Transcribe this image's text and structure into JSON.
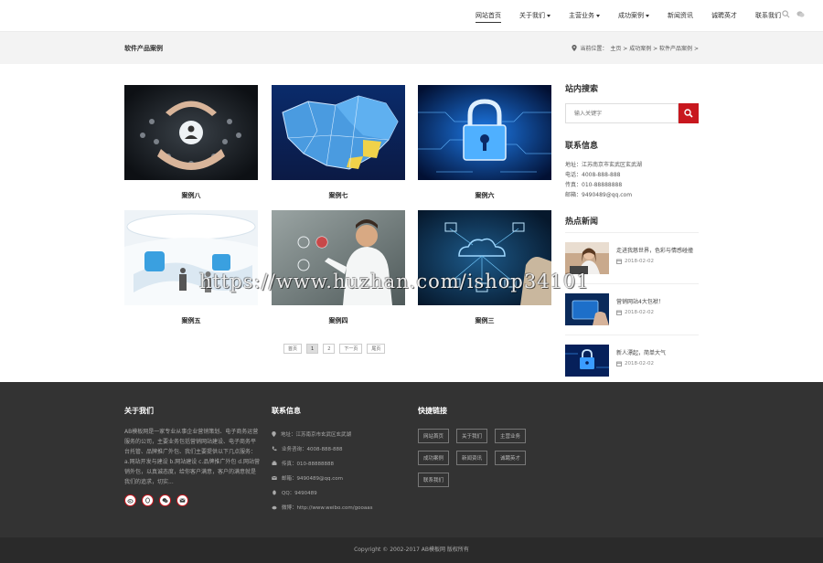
{
  "nav": {
    "items": [
      {
        "label": "网站首页",
        "active": true,
        "dropdown": false
      },
      {
        "label": "关于我们",
        "active": false,
        "dropdown": true
      },
      {
        "label": "主营业务",
        "active": false,
        "dropdown": true
      },
      {
        "label": "成功案例",
        "active": false,
        "dropdown": true
      },
      {
        "label": "新闻资讯",
        "active": false,
        "dropdown": false
      },
      {
        "label": "诚聘英才",
        "active": false,
        "dropdown": false
      },
      {
        "label": "联系我们",
        "active": false,
        "dropdown": false
      }
    ],
    "icons": [
      "search-icon",
      "wechat-icon"
    ]
  },
  "crumbbar": {
    "title": "软件产品案例",
    "location_label": "当前位置：",
    "path": "主页 > 成功案例 > 软件产品案例 >"
  },
  "cases": [
    {
      "caption": "案例八",
      "image": "handshake-people-network"
    },
    {
      "caption": "案例七",
      "image": "map-china-3d"
    },
    {
      "caption": "案例六",
      "image": "padlock-circuit-blue"
    },
    {
      "caption": "案例五",
      "image": "futuristic-white-interior"
    },
    {
      "caption": "案例四",
      "image": "businessman-touchscreen"
    },
    {
      "caption": "案例三",
      "image": "hand-cloud-icons"
    }
  ],
  "pagination": {
    "items": [
      {
        "label": "首页",
        "current": false
      },
      {
        "label": "1",
        "current": true
      },
      {
        "label": "2",
        "current": false
      },
      {
        "label": "下一页",
        "current": false
      },
      {
        "label": "尾页",
        "current": false
      }
    ]
  },
  "sidebar": {
    "search_title": "站内搜索",
    "search_placeholder": "输入关键字",
    "contact_title": "联系信息",
    "contact_lines": [
      "地址：江苏南京市玄武区玄武湖",
      "电话：4008-888-888",
      "传真：010-88888888",
      "邮箱：9490489@qq.com"
    ],
    "news_title": "热点新闻",
    "news": [
      {
        "title": "走进我慈世界，色彩与情感碰撞",
        "date": "2018-02-02",
        "image": "woman-laptop"
      },
      {
        "title": "营销网站4大包袱！",
        "date": "2018-02-02",
        "image": "hand-tablet-blue"
      },
      {
        "title": "新人漂起，简单大气",
        "date": "2018-02-02",
        "image": "padlock-blue"
      }
    ]
  },
  "footer": {
    "about_title": "关于我们",
    "about_text": "AB模板网是一家专业从事企业营销策划、电子商务运营服务的公司，主要业务包括营销网站建设、电子商务平台托管、品牌推广外包、我们主要提供以下几点服务：a.网站开发与建设 b.网站建设 c.品牌推广外包 d.网站营销外包，以真诚态度，给你客户满意，客户的满意就是我们的追求，切实...",
    "social_icons": [
      "weibo-icon",
      "qq-icon",
      "wechat-icon",
      "email-icon"
    ],
    "contact_title": "联系信息",
    "contact_lines": [
      {
        "icon": "location-icon",
        "text": "地址：江苏南京市玄武区玄武湖"
      },
      {
        "icon": "phone-icon",
        "text": "业务咨询：4008-888-888"
      },
      {
        "icon": "fax-icon",
        "text": "传真：010-88888888"
      },
      {
        "icon": "email-icon",
        "text": "邮箱：9490489@qq.com"
      },
      {
        "icon": "qq-icon",
        "text": "QQ：9490489"
      },
      {
        "icon": "weibo-icon",
        "text": "微博：http://www.weibo.com/gooaas"
      }
    ],
    "links_title": "快捷链接",
    "links": [
      "网站首页",
      "关于我们",
      "主营业务",
      "成功案例",
      "新闻资讯",
      "诚聘英才",
      "联系我们"
    ],
    "copyright": "Copyright © 2002-2017 AB模板网 版权所有"
  },
  "watermark": "https://www.huzhan.com/ishop34101",
  "colors": {
    "accent": "#c8171e",
    "footer_bg": "#333333",
    "crumb_bg": "#f3f3f3"
  }
}
